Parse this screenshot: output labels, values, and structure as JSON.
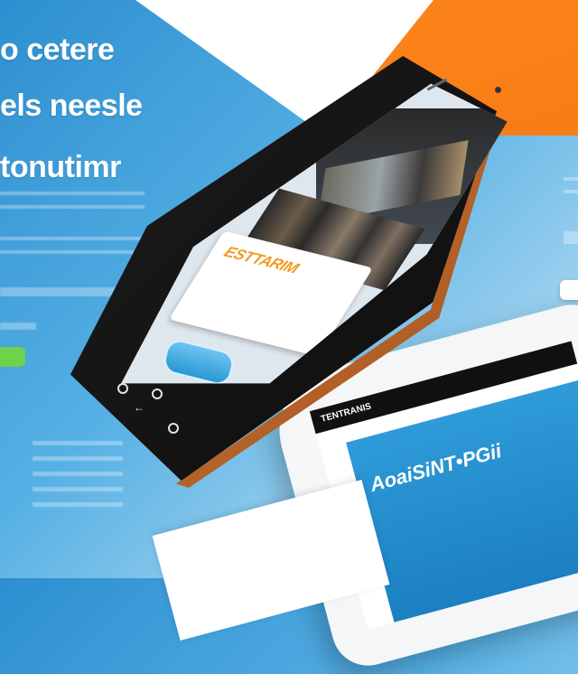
{
  "hero": {
    "line1": "o cetere",
    "line2": "els neesle",
    "line3": "tonutimr"
  },
  "phone_screen": {
    "card_headline": "ESTTARIM"
  },
  "tablet": {
    "header_label": "TENTRANIS",
    "hero_title": "AoaiSiNT•PGii"
  },
  "colors": {
    "background_blue": "#2d8fd0",
    "accent_orange": "#f06a10",
    "cta_green": "#6ed24a",
    "phone_body": "#111111",
    "phone_rim": "#c06a30"
  }
}
